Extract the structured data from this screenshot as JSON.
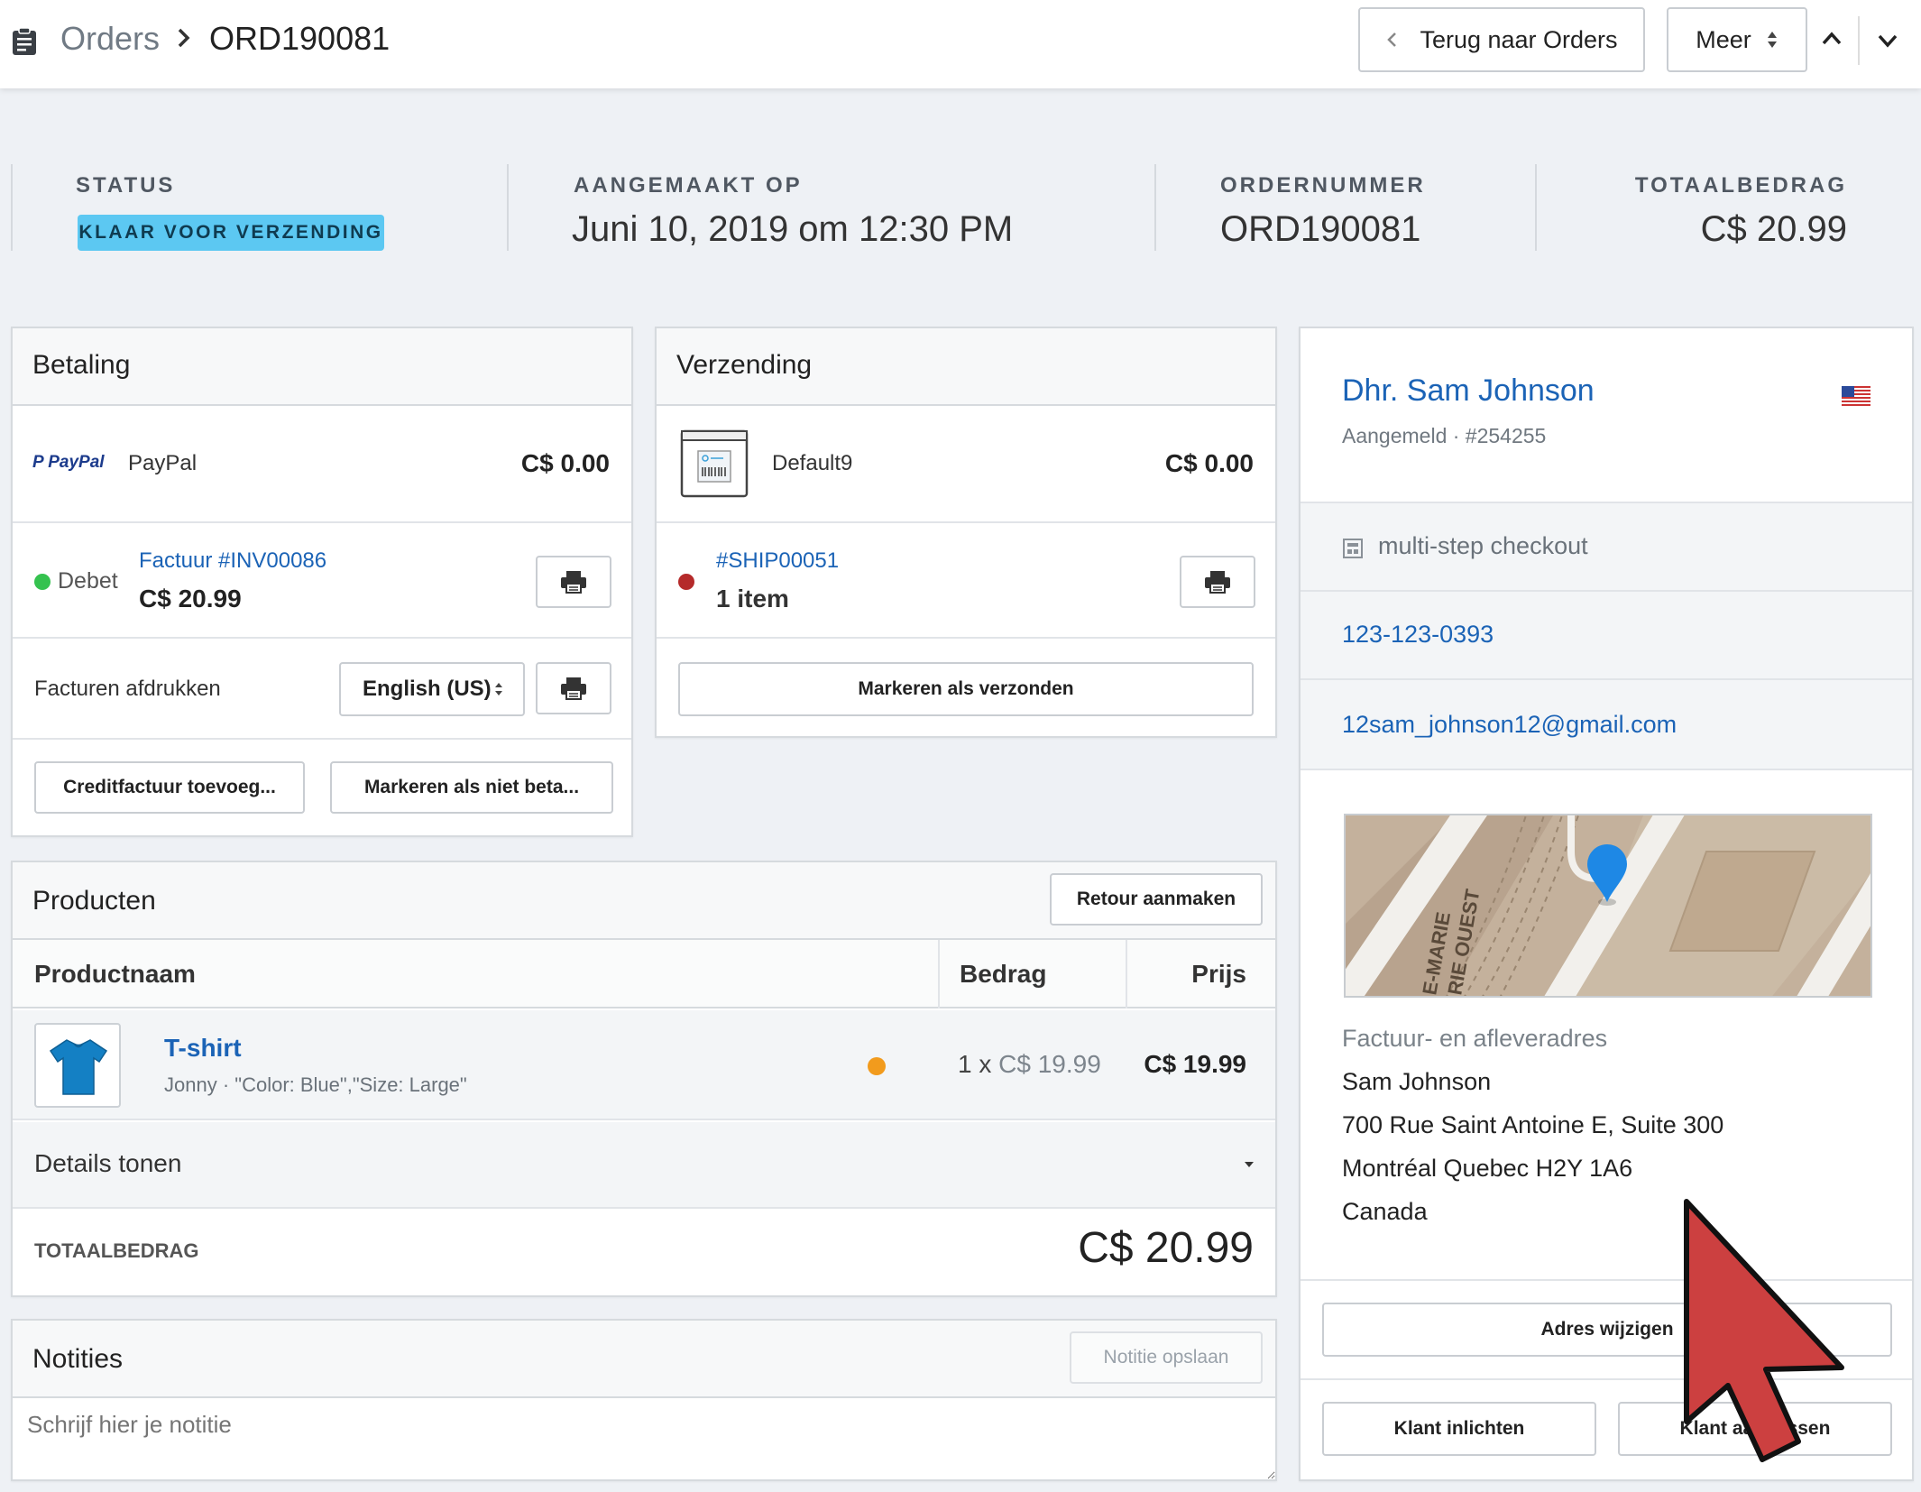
{
  "header": {
    "breadcrumb_root": "Orders",
    "order_id": "ORD190081",
    "back_button": "Terug naar Orders",
    "more_button": "Meer"
  },
  "summary": {
    "status_label": "STATUS",
    "status_value": "KLAAR VOOR VERZENDING",
    "created_label": "AANGEMAAKT OP",
    "created_value": "Juni 10, 2019 om 12:30 PM",
    "order_label": "ORDERNUMMER",
    "order_value": "ORD190081",
    "total_label": "TOTAALBEDRAG",
    "total_value": "C$ 20.99"
  },
  "payment": {
    "title": "Betaling",
    "provider_logo": "PayPal",
    "provider_name": "PayPal",
    "provider_amount": "C$ 0.00",
    "debit_label": "Debet",
    "invoice_link": "Factuur #INV00086",
    "invoice_amount": "C$ 20.99",
    "print_label": "Facturen afdrukken",
    "language_select": "English (US)",
    "credit_button": "Creditfactuur toevoeg...",
    "unpaid_button": "Markeren als niet beta..."
  },
  "shipping": {
    "title": "Verzending",
    "method_name": "Default9",
    "method_amount": "C$ 0.00",
    "shipment_link": "#SHIP00051",
    "shipment_items": "1 item",
    "mark_shipped_button": "Markeren als verzonden"
  },
  "products": {
    "title": "Producten",
    "return_button": "Retour aanmaken",
    "col_name": "Productnaam",
    "col_amount": "Bedrag",
    "col_price": "Prijs",
    "items": [
      {
        "name": "T-shirt",
        "meta": "Jonny · \"Color: Blue\",\"Size: Large\"",
        "qty_prefix": "1 x",
        "unit_price": "C$ 19.99",
        "price": "C$ 19.99"
      }
    ],
    "details_toggle": "Details tonen",
    "total_label": "TOTAALBEDRAG",
    "total_value": "C$ 20.99"
  },
  "notes": {
    "title": "Notities",
    "save_button": "Notitie opslaan",
    "placeholder": "Schrijf hier je notitie"
  },
  "customer": {
    "name": "Dhr. Sam Johnson",
    "meta": "Aangemeld · #254255",
    "checkout": "multi-step checkout",
    "phone": "123-123-0393",
    "email": "12sam_johnson12@gmail.com",
    "map_street_1": "E-MARIE",
    "map_street_2": "RIE OUEST",
    "address_label": "Factuur- en afleveradres",
    "address_lines": [
      "Sam Johnson",
      "700 Rue Saint Antoine E, Suite 300",
      "Montréal Quebec H2Y 1A6",
      "Canada"
    ],
    "change_address_button": "Adres wijzigen",
    "notify_button": "Klant inlichten",
    "customer_button": "Klant aanpassen"
  },
  "colors": {
    "accent_link": "#1b63b6",
    "status_badge": "#5cc8f2",
    "dot_green": "#35c24f",
    "dot_red": "#b52a2a",
    "dot_orange": "#f29b1d",
    "cursor_red": "#cc4040"
  }
}
